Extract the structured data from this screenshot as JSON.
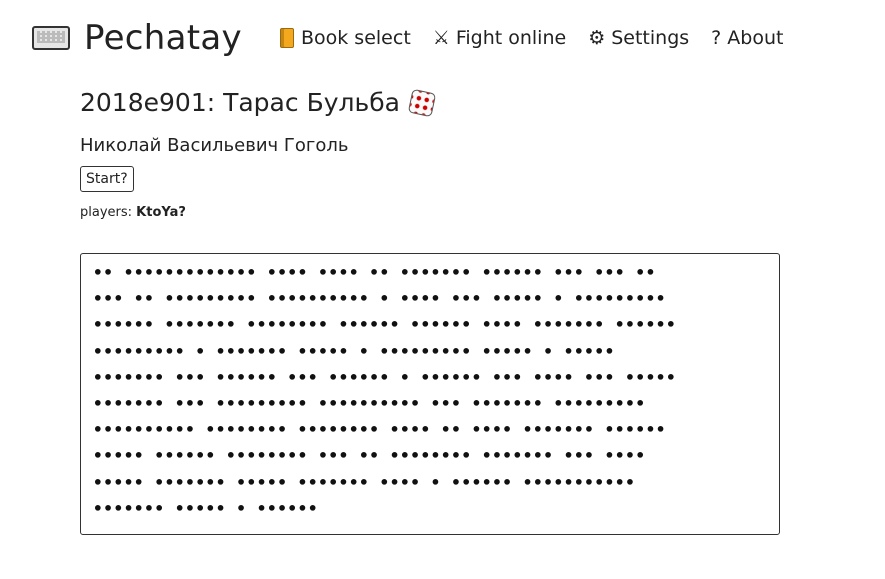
{
  "header": {
    "app_name": "Pechatay",
    "nav": [
      {
        "label": "Book select",
        "icon": "book-icon"
      },
      {
        "label": "Fight online",
        "icon": "crossed-swords-icon"
      },
      {
        "label": "Settings",
        "icon": "gear-icon"
      },
      {
        "label": "About",
        "icon": "question-icon"
      }
    ]
  },
  "book": {
    "title": "2018e901: Тарас Бульба",
    "author": "Николай Васильевич Гоголь"
  },
  "controls": {
    "start_label": "Start?"
  },
  "players": {
    "label": "players:",
    "name": "KtoYa?"
  },
  "masked_text": [
    "•• ••••••••••••• •••• •••• •• ••••••• •••••• ••• ••• ••",
    "••• •• ••••••••• •••••••••• • •••• ••• ••••• • •••••••••",
    "•••••• ••••••• •••••••• •••••• •••••• •••• ••••••• ••••••",
    "••••••••• • ••••••• ••••• • ••••••••• ••••• • •••••",
    "••••••• ••• •••••• ••• •••••• • •••••• ••• •••• ••• •••••",
    "••••••• ••• ••••••••• •••••••••• ••• ••••••• •••••••••",
    "•••••••••• •••••••• •••••••• •••• •• •••• ••••••• ••••••",
    "••••• •••••• •••••••• ••• •• •••••••• ••••••• ••• ••••",
    "••••• ••••••• ••••• ••••••• •••• • •••••• •••••••••••",
    "••••••• ••••• • ••••••"
  ]
}
